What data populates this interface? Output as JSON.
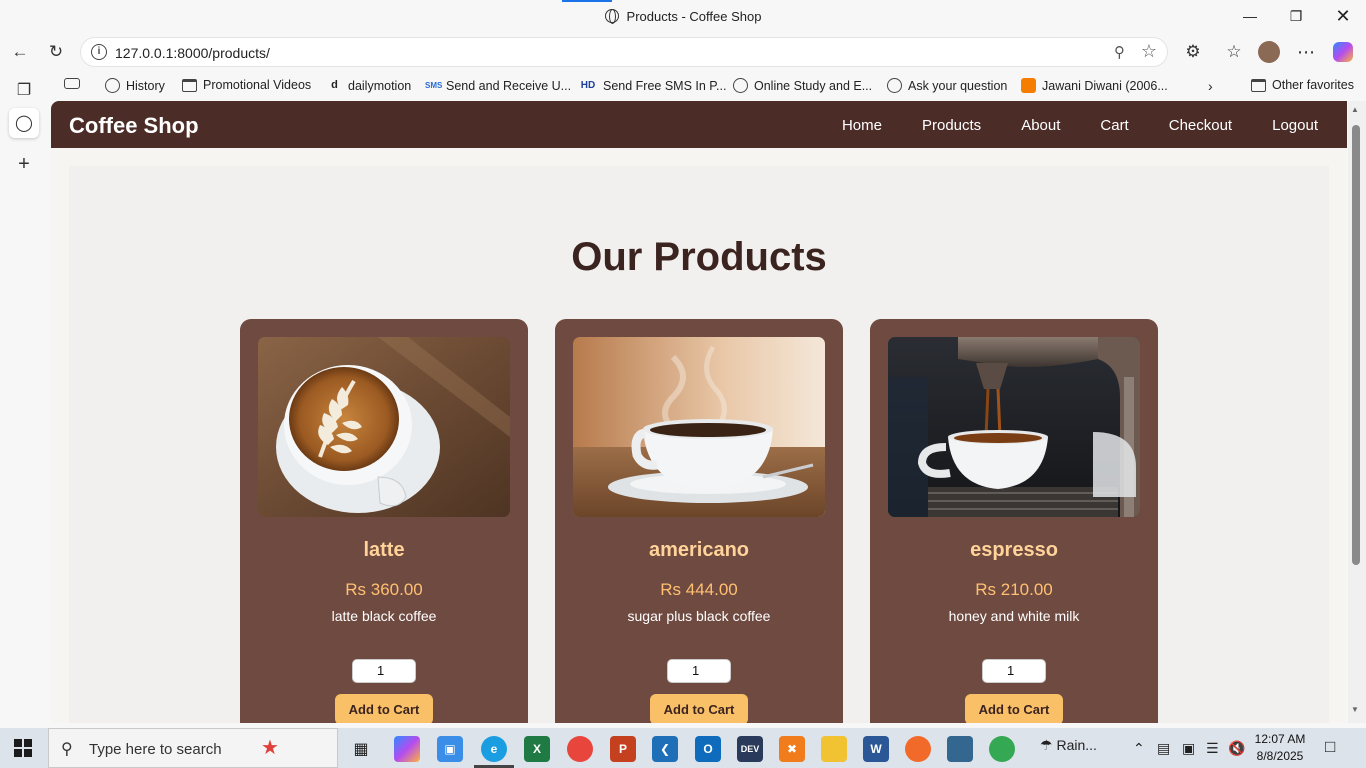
{
  "browser": {
    "window_title": "Products - Coffee Shop",
    "url": "127.0.0.1:8000/products/",
    "bookmarks": [
      {
        "label": "History",
        "icon": "globe-icon"
      },
      {
        "label": "Promotional Videos",
        "icon": "folder-icon"
      },
      {
        "label": "dailymotion",
        "icon": "dailymotion-icon"
      },
      {
        "label": "Send and Receive U...",
        "icon": "sms-icon"
      },
      {
        "label": "Send Free SMS In P...",
        "icon": "hd-icon"
      },
      {
        "label": "Online Study and E...",
        "icon": "globe-icon"
      },
      {
        "label": "Ask your question",
        "icon": "globe-icon"
      },
      {
        "label": "Jawani Diwani (2006...",
        "icon": "blogger-icon"
      }
    ],
    "other_favorites": "Other favorites"
  },
  "site": {
    "brand": "Coffee Shop",
    "nav": [
      "Home",
      "Products",
      "About",
      "Cart",
      "Checkout",
      "Logout"
    ],
    "heading": "Our Products",
    "colors": {
      "navbar": "#4b2c27",
      "card": "#6f4a40",
      "accent": "#f9c068",
      "name": "#ffd39a"
    }
  },
  "products": [
    {
      "name": "latte",
      "price": "Rs 360.00",
      "description": "latte black coffee",
      "quantity": "1",
      "button": "Add to Cart"
    },
    {
      "name": "americano",
      "price": "Rs 444.00",
      "description": "sugar plus black coffee",
      "quantity": "1",
      "button": "Add to Cart"
    },
    {
      "name": "espresso",
      "price": "Rs 210.00",
      "description": "honey and white milk",
      "quantity": "1",
      "button": "Add to Cart"
    }
  ],
  "taskbar": {
    "search_placeholder": "Type here to search",
    "weather": "Rain...",
    "time": "12:07 AM",
    "date": "8/8/2025"
  }
}
